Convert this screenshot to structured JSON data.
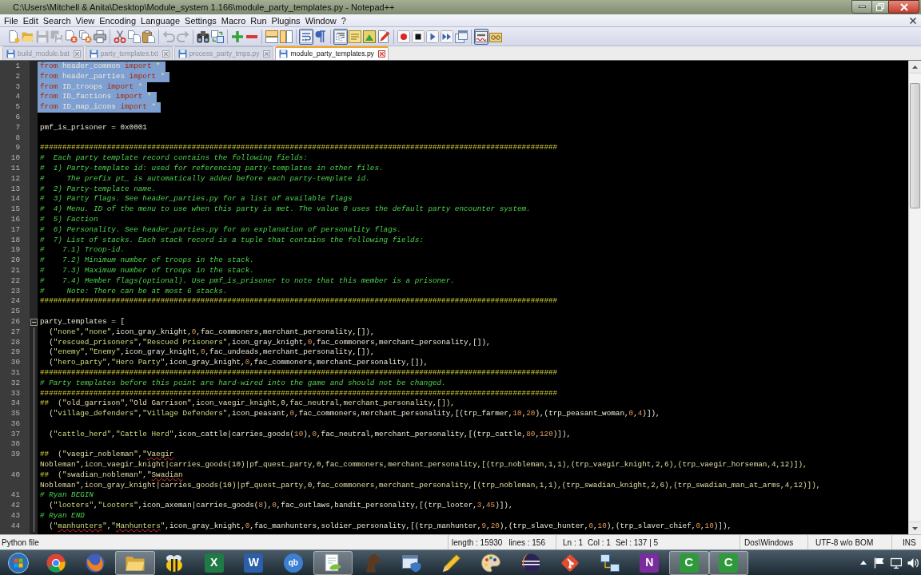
{
  "window": {
    "title": "C:\\Users\\Mitchell & Anita\\Desktop\\Module_system 1.166\\module_party_templates.py - Notepad++"
  },
  "menu": [
    "File",
    "Edit",
    "Search",
    "View",
    "Encoding",
    "Language",
    "Settings",
    "Macro",
    "Run",
    "Plugins",
    "Window",
    "?"
  ],
  "toolbar": {
    "save": {
      "disabled": true
    },
    "save_all": {
      "disabled": true
    },
    "undo": {
      "disabled": true
    },
    "redo": {
      "disabled": true
    },
    "word_wrap": {
      "on": true
    },
    "show_all_characters": {
      "on": false
    },
    "indent_guide": {
      "on": true
    },
    "spell_check": {
      "on": true
    }
  },
  "tabs": [
    {
      "label": "build_module.bat",
      "selected": false
    },
    {
      "label": "party_templates.txt",
      "selected": false
    },
    {
      "label": "process_party_tmps.py",
      "selected": false
    },
    {
      "label": "module_party_templates.py",
      "selected": true
    }
  ],
  "editor": {
    "lines": [
      {
        "number": "1",
        "rows": [
          {
            "selected": true,
            "segments": [
              {
                "kind": "kw",
                "text": "from"
              },
              {
                "kind": "id",
                "text": " header_common "
              },
              {
                "kind": "kw",
                "text": "import"
              },
              {
                "kind": "op",
                "text": " *"
              }
            ]
          }
        ]
      },
      {
        "number": "2",
        "rows": [
          {
            "selected": true,
            "segments": [
              {
                "kind": "kw",
                "text": "from"
              },
              {
                "kind": "id",
                "text": " header_parties "
              },
              {
                "kind": "kw",
                "text": "import"
              },
              {
                "kind": "op",
                "text": " *"
              }
            ]
          }
        ]
      },
      {
        "number": "3",
        "rows": [
          {
            "selected": true,
            "segments": [
              {
                "kind": "kw",
                "text": "from"
              },
              {
                "kind": "id",
                "text": " ID_troops "
              },
              {
                "kind": "kw",
                "text": "import"
              },
              {
                "kind": "op",
                "text": " *"
              }
            ]
          }
        ]
      },
      {
        "number": "4",
        "rows": [
          {
            "selected": true,
            "segments": [
              {
                "kind": "kw",
                "text": "from"
              },
              {
                "kind": "id",
                "text": " ID_factions "
              },
              {
                "kind": "kw",
                "text": "import"
              },
              {
                "kind": "op",
                "text": " *"
              }
            ]
          }
        ]
      },
      {
        "number": "5",
        "rows": [
          {
            "selected": true,
            "segments": [
              {
                "kind": "kw",
                "text": "from"
              },
              {
                "kind": "id",
                "text": " ID_map_icons "
              },
              {
                "kind": "kw",
                "text": "import"
              },
              {
                "kind": "op",
                "text": " *"
              }
            ]
          }
        ]
      },
      {
        "number": "6"
      },
      {
        "number": "7",
        "rows": [
          {
            "selected": false,
            "segments": [
              {
                "kind": "id",
                "text": "pmf_is_prisoner = 0x0001"
              }
            ]
          }
        ]
      },
      {
        "number": "8"
      },
      {
        "number": "9",
        "rows": [
          {
            "selected": false,
            "segments": [
              {
                "kind": "banner",
                "text": "####################################################################################################################"
              }
            ]
          }
        ]
      },
      {
        "number": "10",
        "rows": [
          {
            "selected": false,
            "segments": [
              {
                "kind": "comment",
                "text": "#  Each party template record contains the following fields:"
              }
            ]
          }
        ]
      },
      {
        "number": "11",
        "rows": [
          {
            "selected": false,
            "segments": [
              {
                "kind": "comment",
                "text": "#  1) Party-template id: used for referencing party-templates in other files."
              }
            ]
          }
        ]
      },
      {
        "number": "12",
        "rows": [
          {
            "selected": false,
            "segments": [
              {
                "kind": "comment",
                "text": "#     The prefix pt_ is automatically added before each party-template id."
              }
            ]
          }
        ]
      },
      {
        "number": "13",
        "rows": [
          {
            "selected": false,
            "segments": [
              {
                "kind": "comment",
                "text": "#  2) Party-template name."
              }
            ]
          }
        ]
      },
      {
        "number": "14",
        "rows": [
          {
            "selected": false,
            "segments": [
              {
                "kind": "comment",
                "text": "#  3) Party flags. See header_parties.py for a list of available flags"
              }
            ]
          }
        ]
      },
      {
        "number": "15",
        "rows": [
          {
            "selected": false,
            "segments": [
              {
                "kind": "comment",
                "text": "#  4) Menu. ID of the menu to use when this party is met. The value 0 uses the default party encounter system."
              }
            ]
          }
        ]
      },
      {
        "number": "16",
        "rows": [
          {
            "selected": false,
            "segments": [
              {
                "kind": "comment",
                "text": "#  5) Faction"
              }
            ]
          }
        ]
      },
      {
        "number": "17",
        "rows": [
          {
            "selected": false,
            "segments": [
              {
                "kind": "comment",
                "text": "#  6) Personality. See header_parties.py for an explanation of personality flags."
              }
            ]
          }
        ]
      },
      {
        "number": "18",
        "rows": [
          {
            "selected": false,
            "segments": [
              {
                "kind": "comment",
                "text": "#  7) List of stacks. Each stack record is a tuple that contains the following fields:"
              }
            ]
          }
        ]
      },
      {
        "number": "19",
        "rows": [
          {
            "selected": false,
            "segments": [
              {
                "kind": "comment",
                "text": "#    7.1) Troop-id."
              }
            ]
          }
        ]
      },
      {
        "number": "20",
        "rows": [
          {
            "selected": false,
            "segments": [
              {
                "kind": "comment",
                "text": "#    7.2) Minimum number of troops in the stack."
              }
            ]
          }
        ]
      },
      {
        "number": "21",
        "rows": [
          {
            "selected": false,
            "segments": [
              {
                "kind": "comment",
                "text": "#    7.3) Maximum number of troops in the stack."
              }
            ]
          }
        ]
      },
      {
        "number": "22",
        "rows": [
          {
            "selected": false,
            "segments": [
              {
                "kind": "comment",
                "text": "#    7.4) Member flags(optional). Use pmf_is_prisoner to note that this member is a prisoner."
              }
            ]
          }
        ]
      },
      {
        "number": "23",
        "rows": [
          {
            "selected": false,
            "segments": [
              {
                "kind": "comment",
                "text": "#     Note: There can be at most 6 stacks."
              }
            ]
          }
        ]
      },
      {
        "number": "24",
        "rows": [
          {
            "selected": false,
            "segments": [
              {
                "kind": "banner",
                "text": "####################################################################################################################"
              }
            ]
          }
        ]
      },
      {
        "number": "25"
      },
      {
        "number": "26",
        "fold": {
          "expanded": true
        },
        "rows": [
          {
            "selected": false,
            "segments": [
              {
                "kind": "id",
                "text": "party_templates = ["
              }
            ]
          }
        ]
      },
      {
        "number": "27",
        "rows": [
          {
            "selected": false,
            "segments": [
              {
                "kind": "id",
                "text": "  ("
              },
              {
                "kind": "str",
                "text": "\"none\""
              },
              {
                "kind": "id",
                "text": ","
              },
              {
                "kind": "str",
                "text": "\"none\""
              },
              {
                "kind": "id",
                "text": ",icon_gray_knight,"
              },
              {
                "kind": "num",
                "text": "0"
              },
              {
                "kind": "id",
                "text": ",fac_commoners,merchant_personality,[]),"
              }
            ]
          }
        ]
      },
      {
        "number": "28",
        "rows": [
          {
            "selected": false,
            "segments": [
              {
                "kind": "id",
                "text": "  ("
              },
              {
                "kind": "str",
                "text": "\"rescued_prisoners\""
              },
              {
                "kind": "id",
                "text": ","
              },
              {
                "kind": "str",
                "text": "\"Rescued Prisoners\""
              },
              {
                "kind": "id",
                "text": ",icon_gray_knight,"
              },
              {
                "kind": "num",
                "text": "0"
              },
              {
                "kind": "id",
                "text": ",fac_commoners,merchant_personality,[]),"
              }
            ]
          }
        ]
      },
      {
        "number": "29",
        "rows": [
          {
            "selected": false,
            "segments": [
              {
                "kind": "id",
                "text": "  ("
              },
              {
                "kind": "str",
                "text": "\"enemy\""
              },
              {
                "kind": "id",
                "text": ","
              },
              {
                "kind": "str",
                "text": "\"Enemy\""
              },
              {
                "kind": "id",
                "text": ",icon_gray_knight,"
              },
              {
                "kind": "num",
                "text": "0"
              },
              {
                "kind": "id",
                "text": ",fac_undeads,merchant_personality,[]),"
              }
            ]
          }
        ]
      },
      {
        "number": "30",
        "rows": [
          {
            "selected": false,
            "segments": [
              {
                "kind": "id",
                "text": "  ("
              },
              {
                "kind": "str",
                "text": "\"hero_party\""
              },
              {
                "kind": "id",
                "text": ","
              },
              {
                "kind": "str",
                "text": "\"Hero Party\""
              },
              {
                "kind": "id",
                "text": ",icon_gray_knight,"
              },
              {
                "kind": "num",
                "text": "0"
              },
              {
                "kind": "id",
                "text": ",fac_commoners,merchant_personality,[]),"
              }
            ]
          }
        ]
      },
      {
        "number": "31",
        "rows": [
          {
            "selected": false,
            "segments": [
              {
                "kind": "banner",
                "text": "####################################################################################################################"
              }
            ]
          }
        ]
      },
      {
        "number": "32",
        "rows": [
          {
            "selected": false,
            "segments": [
              {
                "kind": "comment",
                "text": "# Party templates before this point are hard-wired into the game and should not be changed."
              }
            ]
          }
        ]
      },
      {
        "number": "33",
        "rows": [
          {
            "selected": false,
            "segments": [
              {
                "kind": "banner",
                "text": "####################################################################################################################"
              }
            ]
          }
        ]
      },
      {
        "number": "34",
        "rows": [
          {
            "selected": false,
            "segments": [
              {
                "kind": "banner",
                "text": "##"
              },
              {
                "kind": "block",
                "text": "  (\"old_garrison\",\"Old Garrison\",icon_vaegir_knight,0,fac_neutral,merchant_personality,[]),"
              }
            ]
          }
        ]
      },
      {
        "number": "35",
        "rows": [
          {
            "selected": false,
            "segments": [
              {
                "kind": "id",
                "text": "  ("
              },
              {
                "kind": "str",
                "text": "\"village_defenders\""
              },
              {
                "kind": "id",
                "text": ","
              },
              {
                "kind": "str",
                "text": "\"Village Defenders\""
              },
              {
                "kind": "id",
                "text": ",icon_peasant,"
              },
              {
                "kind": "num",
                "text": "0"
              },
              {
                "kind": "id",
                "text": ",fac_commoners,merchant_personality,[(trp_farmer,"
              },
              {
                "kind": "num",
                "text": "10"
              },
              {
                "kind": "id",
                "text": ","
              },
              {
                "kind": "num",
                "text": "20"
              },
              {
                "kind": "id",
                "text": "),(trp_peasant_woman,"
              },
              {
                "kind": "num",
                "text": "0"
              },
              {
                "kind": "id",
                "text": ","
              },
              {
                "kind": "num",
                "text": "4"
              },
              {
                "kind": "id",
                "text": ")]),"
              }
            ]
          }
        ]
      },
      {
        "number": "36"
      },
      {
        "number": "37",
        "rows": [
          {
            "selected": false,
            "segments": [
              {
                "kind": "id",
                "text": "  ("
              },
              {
                "kind": "str",
                "text": "\"cattle_herd\""
              },
              {
                "kind": "id",
                "text": ","
              },
              {
                "kind": "str",
                "text": "\"Cattle Herd\""
              },
              {
                "kind": "id",
                "text": ",icon_cattle|carries_goods("
              },
              {
                "kind": "num",
                "text": "10"
              },
              {
                "kind": "id",
                "text": "),"
              },
              {
                "kind": "num",
                "text": "0"
              },
              {
                "kind": "id",
                "text": ",fac_neutral,merchant_personality,[(trp_cattle,"
              },
              {
                "kind": "num",
                "text": "80"
              },
              {
                "kind": "id",
                "text": ","
              },
              {
                "kind": "num",
                "text": "120"
              },
              {
                "kind": "id",
                "text": ")]),"
              }
            ]
          }
        ]
      },
      {
        "number": "38"
      },
      {
        "number": "39",
        "rows": [
          {
            "selected": false,
            "segments": [
              {
                "kind": "banner",
                "text": "##"
              },
              {
                "kind": "block",
                "text": "  (\"vaegir_nobleman\",\""
              },
              {
                "kind": "block_misspelled",
                "text": "Vaegir"
              }
            ]
          },
          {
            "selected": false,
            "segments": [
              {
                "kind": "block",
                "text": "Nobleman\",icon_vaegir_knight|carries_goods(10)|pf_quest_party,0,fac_commoners,merchant_personality,[(trp_nobleman,1,1),(trp_vaegir_knight,2,6),(trp_vaegir_horseman,4,12)]),"
              }
            ]
          }
        ]
      },
      {
        "number": "40",
        "rows": [
          {
            "selected": false,
            "segments": [
              {
                "kind": "banner",
                "text": "##"
              },
              {
                "kind": "block",
                "text": "  (\"swadian_nobleman\",\""
              },
              {
                "kind": "block_misspelled",
                "text": "Swadian"
              }
            ]
          },
          {
            "selected": false,
            "segments": [
              {
                "kind": "block",
                "text": "Nobleman\",icon_gray_knight|carries_goods(10)|pf_quest_party,0,fac_commoners,merchant_personality,[(trp_nobleman,1,1),(trp_swadian_knight,2,6),(trp_swadian_man_at_arms,4,12)]),"
              }
            ]
          }
        ]
      },
      {
        "number": "41",
        "rows": [
          {
            "selected": false,
            "segments": [
              {
                "kind": "comment",
                "text": "# Ryan BEGIN"
              }
            ]
          }
        ]
      },
      {
        "number": "42",
        "rows": [
          {
            "selected": false,
            "segments": [
              {
                "kind": "id",
                "text": "  ("
              },
              {
                "kind": "str",
                "text": "\"looters\""
              },
              {
                "kind": "id",
                "text": ","
              },
              {
                "kind": "str",
                "text": "\"Looters\""
              },
              {
                "kind": "id",
                "text": ",icon_axeman|carries_goods("
              },
              {
                "kind": "num",
                "text": "8"
              },
              {
                "kind": "id",
                "text": "),"
              },
              {
                "kind": "num",
                "text": "0"
              },
              {
                "kind": "id",
                "text": ",fac_outlaws,bandit_personality,[(trp_looter,"
              },
              {
                "kind": "num",
                "text": "3"
              },
              {
                "kind": "id",
                "text": ","
              },
              {
                "kind": "num",
                "text": "45"
              },
              {
                "kind": "id",
                "text": ")]),"
              }
            ]
          }
        ]
      },
      {
        "number": "43",
        "rows": [
          {
            "selected": false,
            "segments": [
              {
                "kind": "comment",
                "text": "# Ryan END"
              }
            ]
          }
        ]
      },
      {
        "number": "44",
        "rows": [
          {
            "selected": false,
            "segments": [
              {
                "kind": "id",
                "text": "  ("
              },
              {
                "kind": "str",
                "text": "\""
              },
              {
                "kind": "str_misspelled",
                "text": "manhunters"
              },
              {
                "kind": "str",
                "text": "\""
              },
              {
                "kind": "id",
                "text": ","
              },
              {
                "kind": "str",
                "text": "\""
              },
              {
                "kind": "str_misspelled",
                "text": "Manhunters"
              },
              {
                "kind": "str",
                "text": "\""
              },
              {
                "kind": "id",
                "text": ",icon_gray_knight,"
              },
              {
                "kind": "num",
                "text": "0"
              },
              {
                "kind": "id",
                "text": ",fac_manhunters,soldier_personality,[(trp_manhunter,"
              },
              {
                "kind": "num",
                "text": "9"
              },
              {
                "kind": "id",
                "text": ","
              },
              {
                "kind": "num",
                "text": "20"
              },
              {
                "kind": "id",
                "text": "),(trp_slave_hunter,"
              },
              {
                "kind": "num",
                "text": "0"
              },
              {
                "kind": "id",
                "text": ","
              },
              {
                "kind": "num",
                "text": "10"
              },
              {
                "kind": "id",
                "text": "),(trp_slaver_chief,"
              },
              {
                "kind": "num",
                "text": "0"
              },
              {
                "kind": "id",
                "text": ","
              },
              {
                "kind": "num",
                "text": "10"
              },
              {
                "kind": "id",
                "text": ")]),"
              }
            ]
          }
        ]
      }
    ]
  },
  "status_bar": {
    "file_type": "Python file",
    "length": "length : 15930",
    "lines": "lines : 156",
    "ln": "Ln : 1",
    "col": "Col : 1",
    "sel": "Sel : 137 | 5",
    "eol": "Dos\\Windows",
    "encoding": "UTF-8 w/o BOM",
    "mode": "INS"
  },
  "taskbar": {
    "apps": [
      {
        "active": false
      },
      {
        "active": false
      },
      {
        "active": true
      },
      {
        "active": false
      },
      {
        "active": false,
        "letter": "X"
      },
      {
        "active": false,
        "letter": "W"
      },
      {
        "active": false,
        "letter": "qb"
      },
      {
        "active": true
      },
      {
        "active": false
      },
      {
        "active": false
      },
      {
        "active": false
      },
      {
        "active": false
      },
      {
        "active": false
      },
      {
        "active": false
      },
      {
        "active": false
      },
      {
        "active": false,
        "letter": "N"
      },
      {
        "active": true,
        "letter": "C"
      },
      {
        "active": true,
        "letter": "C"
      }
    ]
  }
}
